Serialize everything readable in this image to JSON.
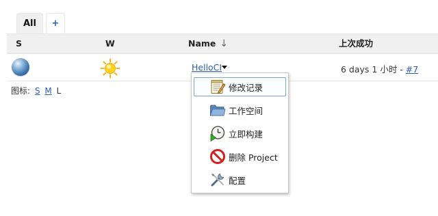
{
  "tabs": [
    {
      "label": "All"
    },
    {
      "label": "+"
    }
  ],
  "table": {
    "headers": {
      "status": "S",
      "weather": "W",
      "name": "Name",
      "sort_indicator": "↓",
      "last_success": "上次成功"
    },
    "rows": [
      {
        "name": "HelloCI",
        "last_success_text": "6 days 1 小时 - ",
        "build_link": "#7"
      }
    ]
  },
  "legend": {
    "label": "图标:",
    "sizes": [
      "S",
      "M",
      "L"
    ]
  },
  "context_menu": {
    "items": [
      {
        "label": "修改记录",
        "icon": "changes-icon"
      },
      {
        "label": "工作空间",
        "icon": "folder-icon"
      },
      {
        "label": "立即构建",
        "icon": "build-now-icon"
      },
      {
        "label": "删除 Project",
        "icon": "delete-icon"
      },
      {
        "label": "配置",
        "icon": "configure-icon"
      }
    ]
  },
  "colors": {
    "link": "#2a5db0",
    "header_bg": "#f0f0f0",
    "menu_highlight_border": "#7da2ce"
  }
}
